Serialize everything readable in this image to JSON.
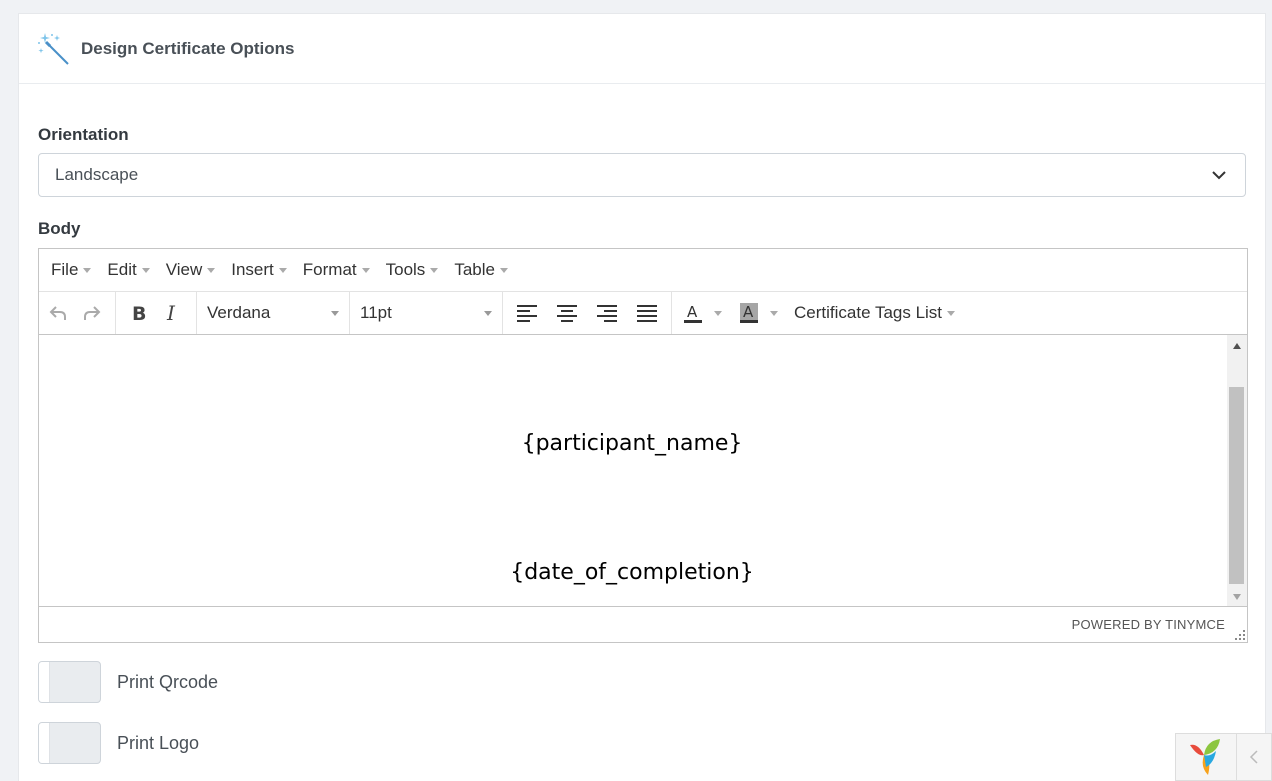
{
  "header": {
    "title": "Design Certificate Options",
    "icon": "magic-wand-icon"
  },
  "orientation": {
    "label": "Orientation",
    "value": "Landscape"
  },
  "body": {
    "label": "Body"
  },
  "editor": {
    "menus": [
      "File",
      "Edit",
      "View",
      "Insert",
      "Format",
      "Tools",
      "Table"
    ],
    "font_family": "Verdana",
    "font_size": "11pt",
    "tags_label": "Certificate Tags List",
    "content": [
      "{participant_name}",
      "{date_of_completion}"
    ],
    "powered_by": "POWERED BY TINYMCE"
  },
  "options": [
    {
      "label": "Print Qrcode",
      "checked": false
    },
    {
      "label": "Print Logo",
      "checked": false
    }
  ]
}
